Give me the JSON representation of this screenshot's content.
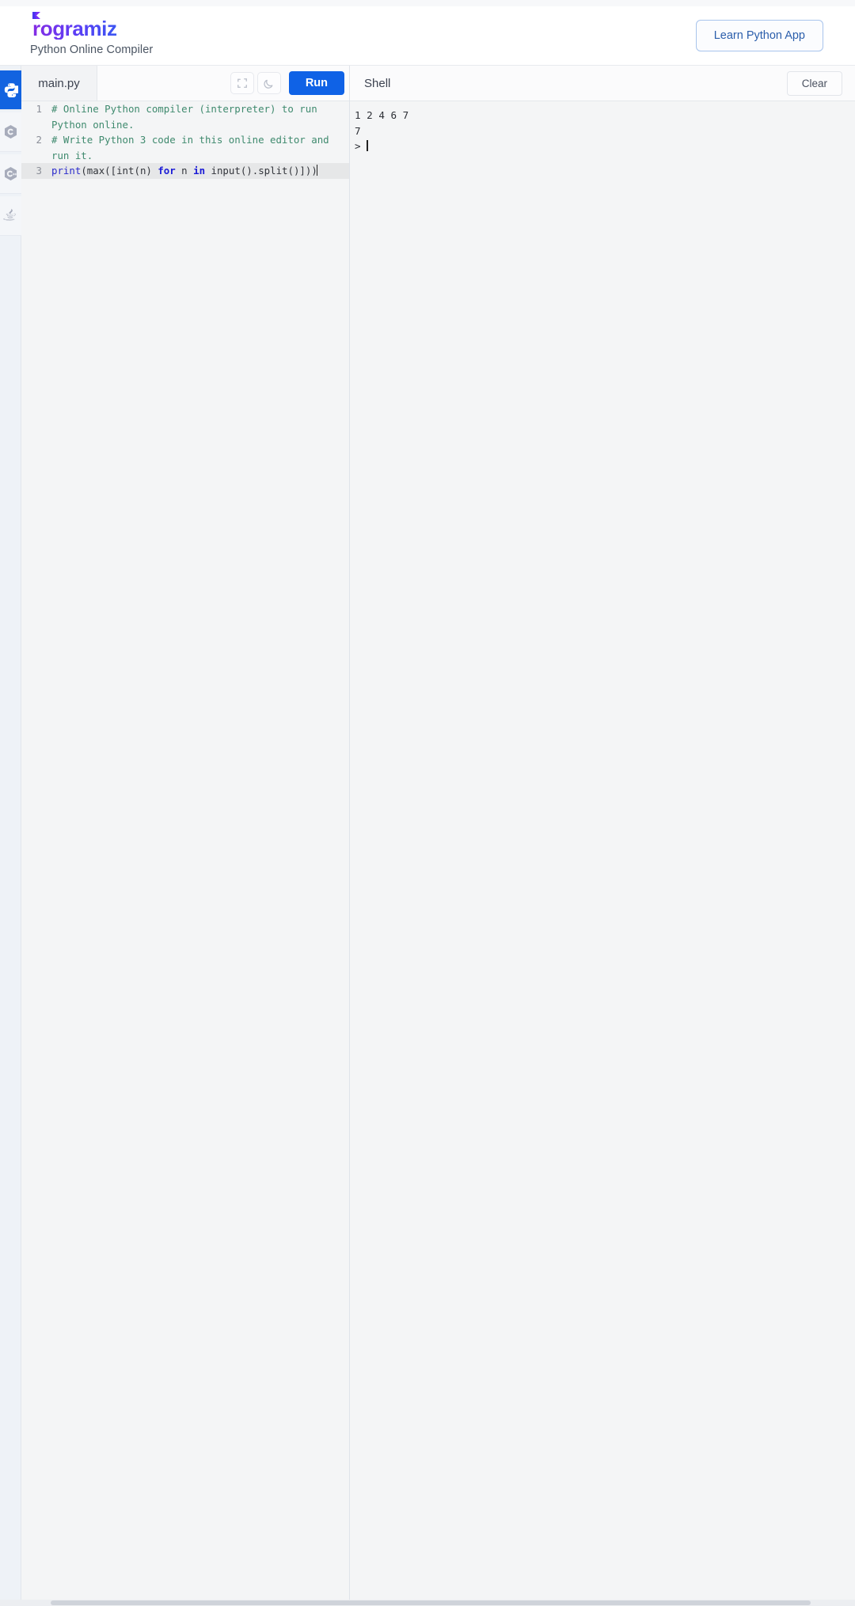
{
  "header": {
    "logo_text": "rogramiz",
    "logo_icon": "programiz-flag-icon",
    "tagline": "Python Online Compiler",
    "learn_button": "Learn Python App",
    "accent_color": "#0f62e6",
    "logo_gradient_from": "#8a2be2",
    "logo_gradient_to": "#1f6df0"
  },
  "sidebar": {
    "items": [
      {
        "label": "Python",
        "icon": "python-icon",
        "active": true
      },
      {
        "label": "C",
        "icon": "c-language-icon",
        "active": false
      },
      {
        "label": "C++",
        "icon": "cpp-language-icon",
        "active": false
      },
      {
        "label": "Java",
        "icon": "java-icon",
        "active": false
      }
    ]
  },
  "editor": {
    "tab_label": "main.py",
    "fullscreen_icon": "fullscreen-icon",
    "theme_icon": "moon-icon",
    "run_label": "Run",
    "active_line": 3,
    "lines": [
      {
        "number": "1",
        "segments": [
          {
            "text": "# Online Python compiler (interpreter) to run Python online.",
            "kind": "comment"
          }
        ]
      },
      {
        "number": "2",
        "segments": [
          {
            "text": "# Write Python 3 code in this online editor and run it.",
            "kind": "comment"
          }
        ]
      },
      {
        "number": "3",
        "segments": [
          {
            "text": "print",
            "kind": "fn"
          },
          {
            "text": "(",
            "kind": "plain"
          },
          {
            "text": "max",
            "kind": "plain"
          },
          {
            "text": "([",
            "kind": "plain"
          },
          {
            "text": "int",
            "kind": "plain"
          },
          {
            "text": "(n) ",
            "kind": "plain"
          },
          {
            "text": "for",
            "kind": "kw"
          },
          {
            "text": " n ",
            "kind": "plain"
          },
          {
            "text": "in",
            "kind": "kw"
          },
          {
            "text": " ",
            "kind": "plain"
          },
          {
            "text": "input",
            "kind": "plain"
          },
          {
            "text": "().",
            "kind": "plain"
          },
          {
            "text": "split",
            "kind": "plain"
          },
          {
            "text": "()]))",
            "kind": "plain"
          }
        ]
      }
    ]
  },
  "shell": {
    "title": "Shell",
    "clear_label": "Clear",
    "output_lines": [
      "1 2 4 6 7",
      "7"
    ],
    "prompt": ">"
  }
}
